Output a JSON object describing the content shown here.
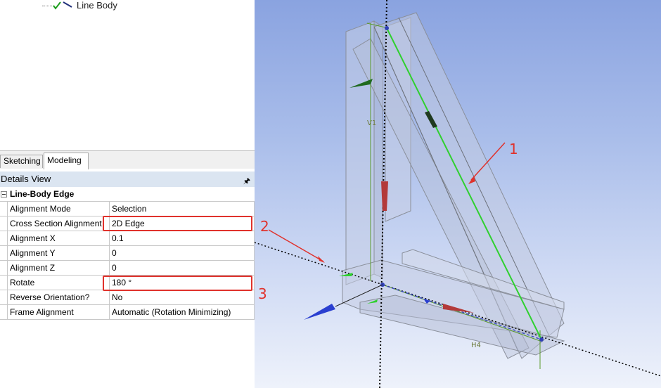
{
  "tree": {
    "item_label": "Line Body"
  },
  "tabs": [
    {
      "label": "Sketching"
    },
    {
      "label": "Modeling"
    }
  ],
  "details": {
    "title": "Details View",
    "group_label": "Line-Body Edge",
    "rows": [
      {
        "name": "Alignment Mode",
        "value": "Selection"
      },
      {
        "name": "Cross Section Alignment",
        "value": "2D Edge"
      },
      {
        "name": "Alignment X",
        "value": "0.1"
      },
      {
        "name": "Alignment Y",
        "value": "0"
      },
      {
        "name": "Alignment Z",
        "value": "0"
      },
      {
        "name": "Rotate",
        "value": "180 °"
      },
      {
        "name": "Reverse Orientation?",
        "value": "No"
      },
      {
        "name": "Frame Alignment",
        "value": "Automatic (Rotation Minimizing)"
      }
    ]
  },
  "annotations": {
    "n1": "1",
    "n2": "2",
    "n3": "3"
  },
  "viewport": {
    "dim_v": "V1",
    "dim_h": "H4"
  },
  "colors": {
    "annotation_red": "#e0322c",
    "selected_edge": "#2fd02f",
    "header_bg": "#dbe5f1"
  }
}
